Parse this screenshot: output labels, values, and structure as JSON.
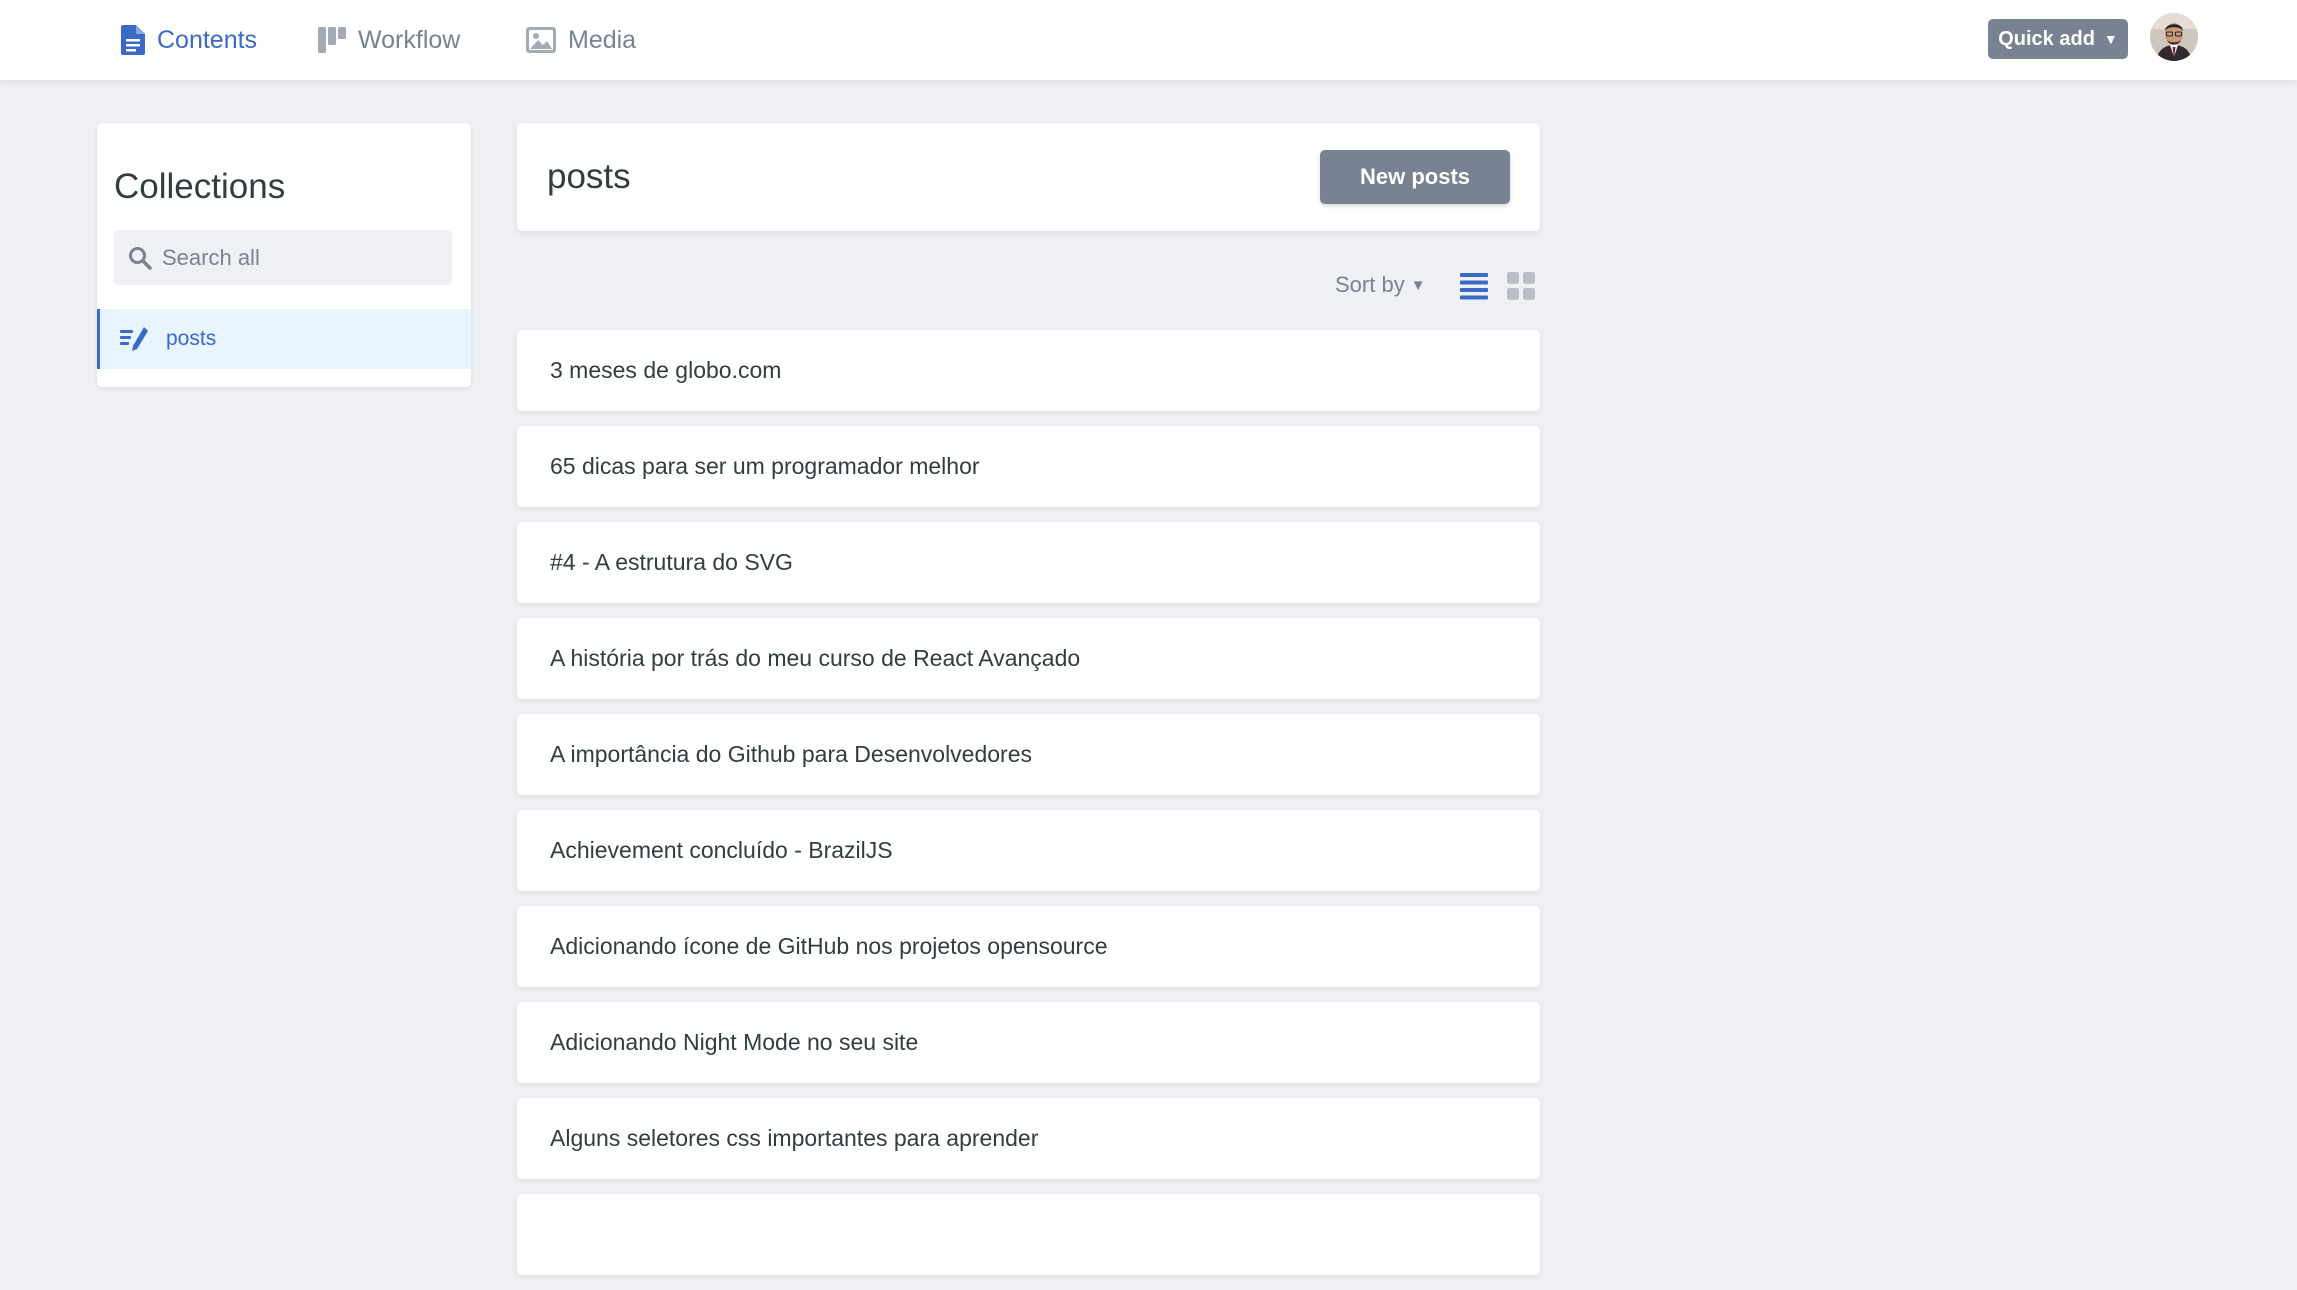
{
  "topbar": {
    "nav": [
      {
        "label": "Contents",
        "icon": "document-icon",
        "active": true
      },
      {
        "label": "Workflow",
        "icon": "kanban-icon",
        "active": false
      },
      {
        "label": "Media",
        "icon": "image-icon",
        "active": false
      }
    ],
    "quick_add_label": "Quick add",
    "avatar": "user-avatar"
  },
  "sidebar": {
    "title": "Collections",
    "search_placeholder": "Search all",
    "collections": [
      {
        "label": "posts",
        "icon": "write-icon",
        "active": true
      }
    ]
  },
  "main": {
    "collection_title": "posts",
    "new_button_label": "New posts",
    "sort_label": "Sort by",
    "view_modes": [
      "list",
      "grid"
    ],
    "active_view": "list",
    "entries": [
      "3 meses de globo.com",
      "65 dicas para ser um programador melhor",
      "#4 - A estrutura do SVG",
      "A história por trás do meu curso de React Avançado",
      "A importância do Github para Desenvolvedores",
      "Achievement concluído - BrazilJS",
      "Adicionando ícone de GitHub nos projetos opensource",
      "Adicionando Night Mode no seu site",
      "Alguns seletores css importantes para aprender"
    ]
  },
  "colors": {
    "accent": "#3a69c7",
    "muted": "#798291",
    "background": "#eff0f4",
    "card": "#ffffff",
    "active_item_bg": "#e8f5fe"
  }
}
